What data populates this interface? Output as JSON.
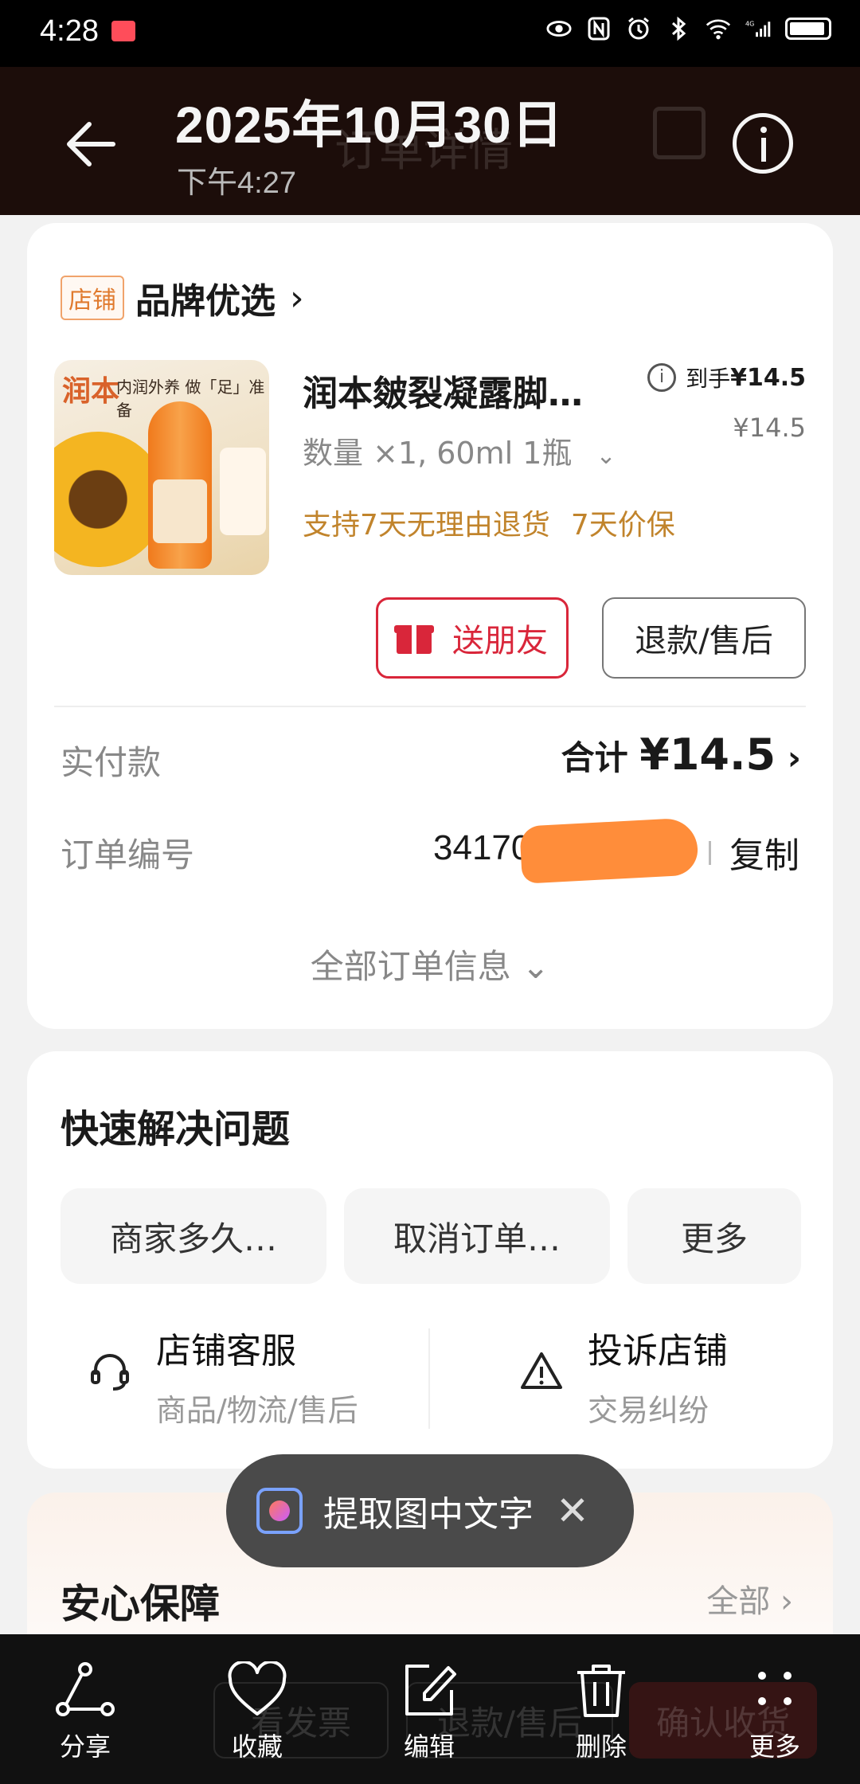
{
  "status_bar": {
    "time": "4:28",
    "network": "4G"
  },
  "header": {
    "title": "2025年10月30日",
    "subtitle": "下午4:27",
    "ghost_title": "订单详情"
  },
  "order": {
    "store_tag": "店铺",
    "store_name": "品牌优选",
    "product": {
      "image_brand": "润本",
      "image_tagline": "内润外养 做「足」准备",
      "name": "润本皴裂凝露脚…",
      "spec": "数量 ×1, 60ml 1瓶",
      "tag_return": "支持7天无理由退货",
      "tag_price_protect": "7天价保",
      "daoshou_label": "到手",
      "daoshou_price": "¥14.5",
      "price": "¥14.5"
    },
    "gift_button": "送朋友",
    "refund_button": "退款/售后",
    "paid_label": "实付款",
    "paid_prefix": "合计",
    "paid_amount": "¥14.5",
    "order_no_label": "订单编号",
    "order_no": "3417071",
    "copy_button": "复制",
    "all_info": "全部订单信息"
  },
  "quick_solve": {
    "title": "快速解决问题",
    "chips": [
      "商家多久…",
      "取消订单…",
      "更多"
    ],
    "service": {
      "title": "店铺客服",
      "subtitle": "商品/物流/售后"
    },
    "complaint": {
      "title": "投诉店铺",
      "subtitle": "交易纠纷"
    }
  },
  "assurance": {
    "title": "安心保障",
    "all": "全部"
  },
  "toast": {
    "text": "提取图中文字"
  },
  "bottom_bar": {
    "ghost_buttons": [
      "看发票",
      "退款/售后",
      "确认收货"
    ],
    "tabs": [
      {
        "label": "分享",
        "icon": "share-icon"
      },
      {
        "label": "收藏",
        "icon": "heart-icon"
      },
      {
        "label": "编辑",
        "icon": "edit-icon"
      },
      {
        "label": "删除",
        "icon": "trash-icon"
      },
      {
        "label": "更多",
        "icon": "more-icon"
      }
    ]
  },
  "colors": {
    "accent_red": "#d9263a",
    "tag_orange": "#c1842c",
    "header_bg": "#1c0d0a"
  }
}
